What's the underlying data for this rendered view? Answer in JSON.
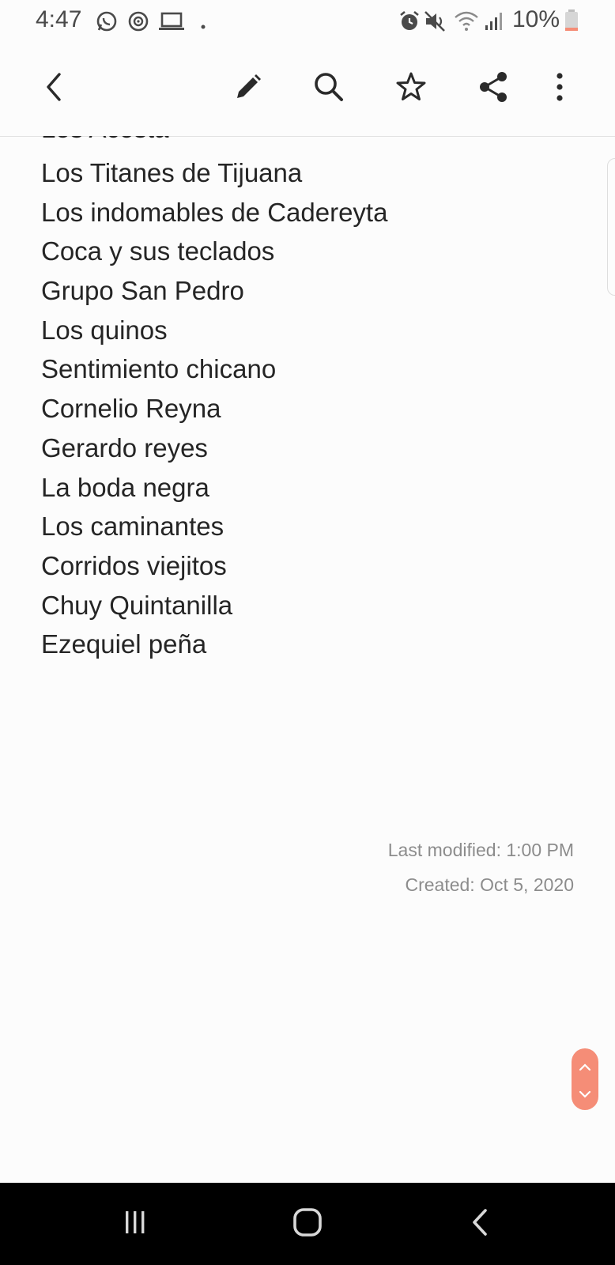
{
  "status_bar": {
    "time": "4:47",
    "battery_percent": "10%",
    "battery_level": 0.1,
    "battery_color": "#f58d77",
    "icons": [
      "whatsapp-icon",
      "sync-icon",
      "laptop-icon",
      "dot-icon",
      "alarm-icon",
      "mute-icon",
      "wifi-icon",
      "signal-icon",
      "battery-icon"
    ]
  },
  "toolbar": {
    "icons": [
      "back-icon",
      "edit-icon",
      "search-icon",
      "star-icon",
      "share-icon",
      "more-icon"
    ]
  },
  "note": {
    "partial_line": "Los Acosta",
    "lines": [
      "Los Titanes de Tijuana",
      "Los indomables de Cadereyta",
      "Coca y sus teclados",
      "Grupo San Pedro",
      "Los quinos",
      "Sentimiento chicano",
      "Cornelio Reyna",
      "Gerardo reyes",
      "La boda negra",
      "Los caminantes",
      "Corridos viejitos",
      "Chuy Quintanilla",
      "Ezequiel peña"
    ]
  },
  "meta": {
    "last_modified": "Last modified: 1:00 PM",
    "created": "Created: Oct 5, 2020"
  },
  "colors": {
    "accent": "#f58d77",
    "background": "#fcfcfc",
    "text": "#252525",
    "meta_text": "#8c8c8c"
  }
}
